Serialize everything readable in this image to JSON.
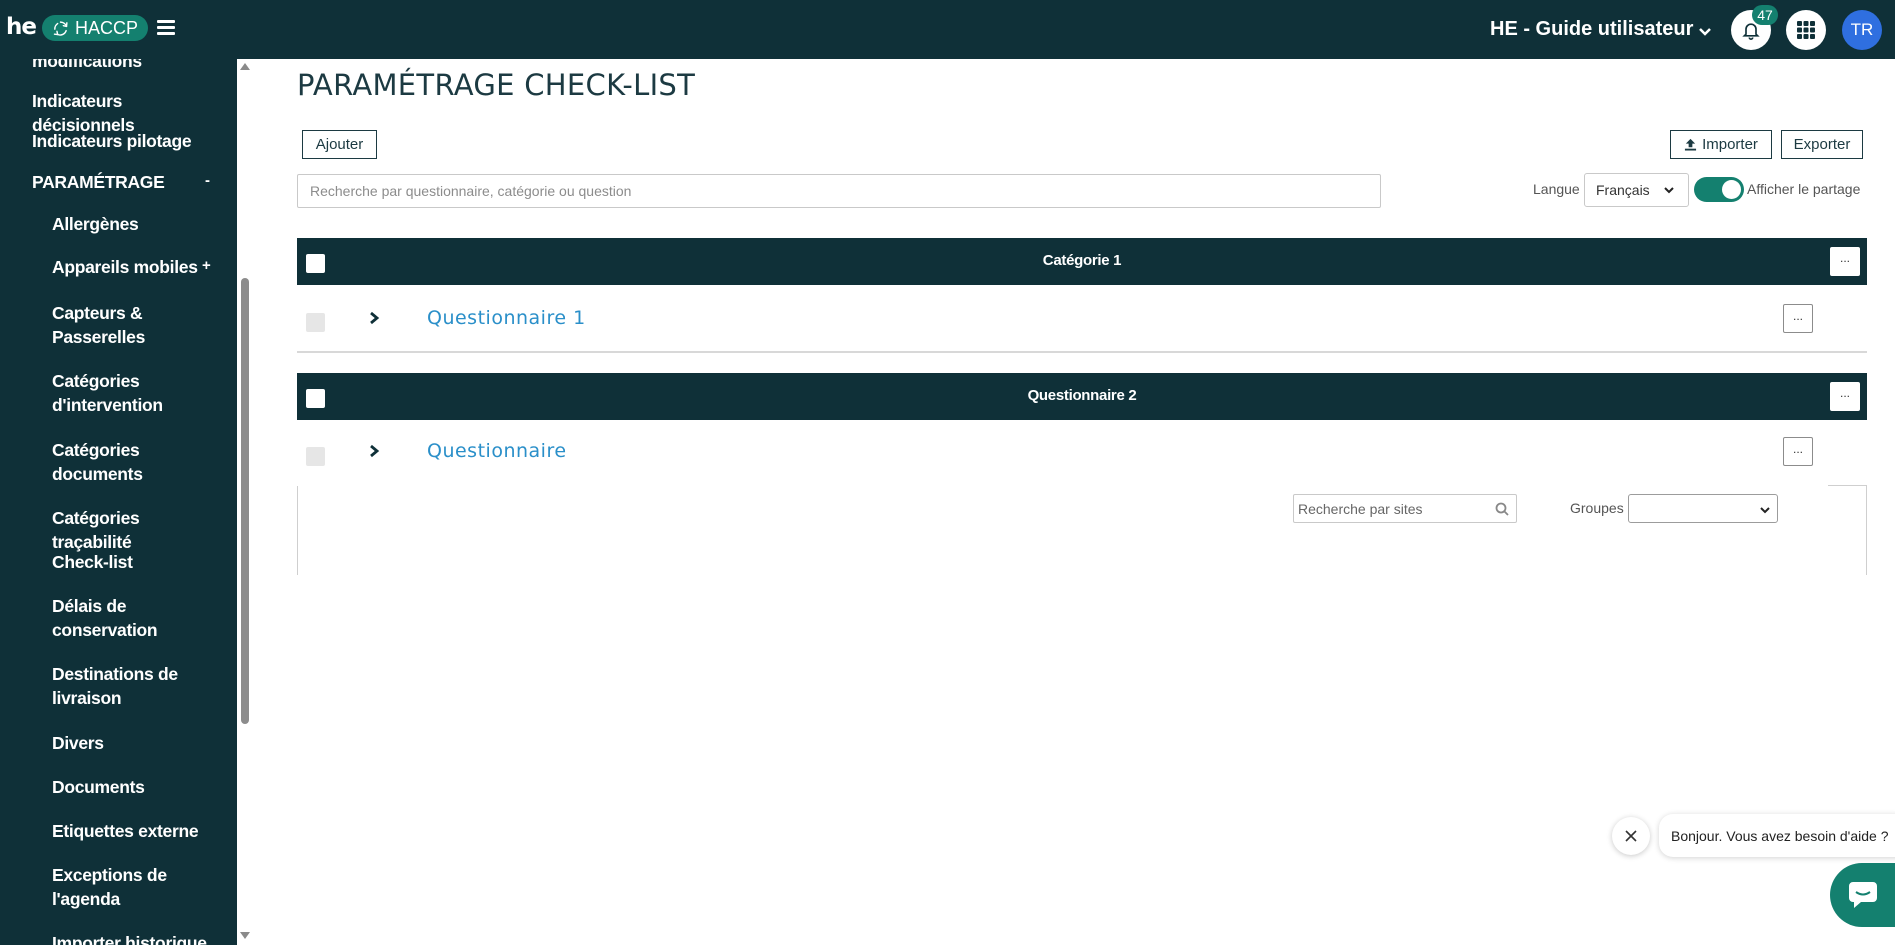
{
  "app": {
    "logo_text": "he",
    "module_badge": "HACCP",
    "org_name": "HE - Guide utilisateur",
    "notifications_count": "47",
    "avatar_initials": "TR"
  },
  "sidebar": {
    "partial_top": "modifications",
    "items": [
      {
        "label": "Indicateurs décisionnels"
      },
      {
        "label": "Indicateurs pilotage"
      },
      {
        "label": "PARAMÉTRAGE",
        "toggle": "-"
      },
      {
        "label": "Allergènes"
      },
      {
        "label": "Appareils mobiles",
        "toggle": "+"
      },
      {
        "label": "Capteurs & Passerelles"
      },
      {
        "label": "Catégories d'intervention"
      },
      {
        "label": "Catégories documents"
      },
      {
        "label": "Catégories traçabilité"
      },
      {
        "label": "Check-list"
      },
      {
        "label": "Délais de conservation"
      },
      {
        "label": "Destinations de livraison"
      },
      {
        "label": "Divers"
      },
      {
        "label": "Documents"
      },
      {
        "label": "Etiquettes externe"
      },
      {
        "label": "Exceptions de l'agenda"
      },
      {
        "label": "Importer historique"
      }
    ]
  },
  "main": {
    "title": "PARAMÉTRAGE CHECK-LIST",
    "add_label": "Ajouter",
    "import_label": "Importer",
    "export_label": "Exporter",
    "search_placeholder": "Recherche par questionnaire, catégorie ou question",
    "language_label": "Langue",
    "language_value": "Français",
    "share_toggle_on": true,
    "share_label": "Afficher le partage",
    "more_label": "...",
    "categories": [
      {
        "title": "Catégorie 1",
        "questionnaire": "Questionnaire 1"
      },
      {
        "title": "Questionnaire 2",
        "questionnaire": "Questionnaire"
      }
    ],
    "sites_search_placeholder": "Recherche par sites",
    "groups_label": "Groupes",
    "groups_value": ""
  },
  "chat": {
    "message": "Bonjour. Vous avez besoin d'aide ?"
  },
  "colors": {
    "dark_teal": "#0f3038",
    "accent_green": "#14806f",
    "link_blue": "#2a8fc9",
    "avatar_blue": "#2f6fe0"
  }
}
